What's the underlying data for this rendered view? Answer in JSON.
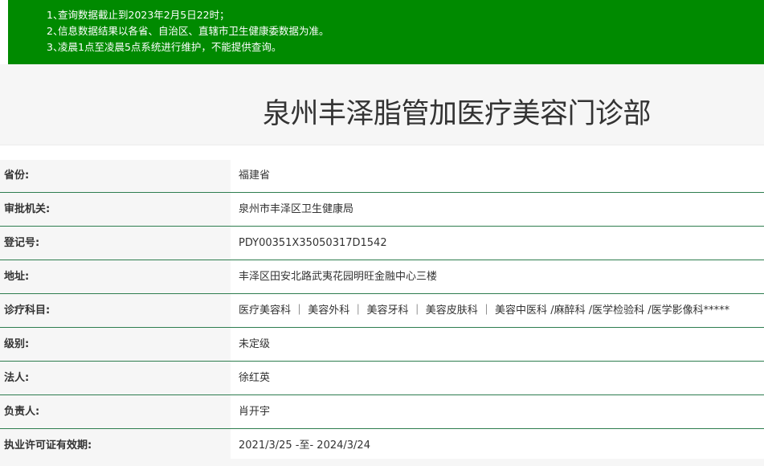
{
  "notice": {
    "items": [
      {
        "num": "1、",
        "text": "查询数据截止到2023年2月5日22时；"
      },
      {
        "num": "2、",
        "text": "信息数据结果以各省、自治区、直辖市卫生健康委数据为准。"
      },
      {
        "num": "3、",
        "text": "凌晨1点至凌晨5点系统进行维护，不能提供查询。"
      }
    ]
  },
  "title": "泉州丰泽脂管加医疗美容门诊部",
  "rows": [
    {
      "label": "省份:",
      "value": "福建省"
    },
    {
      "label": "审批机关:",
      "value": "泉州市丰泽区卫生健康局"
    },
    {
      "label": "登记号:",
      "value": "PDY00351X35050317D1542"
    },
    {
      "label": "地址:",
      "value": "丰泽区田安北路武夷花园明旺金融中心三楼"
    },
    {
      "label": "诊疗科目:",
      "value": "医疗美容科 ｜ 美容外科 ｜ 美容牙科 ｜ 美容皮肤科 ｜ 美容中医科 /麻醉科 /医学检验科 /医学影像科*****"
    },
    {
      "label": "级别:",
      "value": "未定级"
    },
    {
      "label": "法人:",
      "value": "徐红英"
    },
    {
      "label": "负责人:",
      "value": "肖开宇"
    },
    {
      "label": "执业许可证有效期:",
      "value": "2021/3/25 -至- 2024/3/24"
    }
  ],
  "colors": {
    "notice_bg": "#008a00",
    "row_border": "#2e7d4f",
    "label_bg": "#f6f6f6"
  }
}
